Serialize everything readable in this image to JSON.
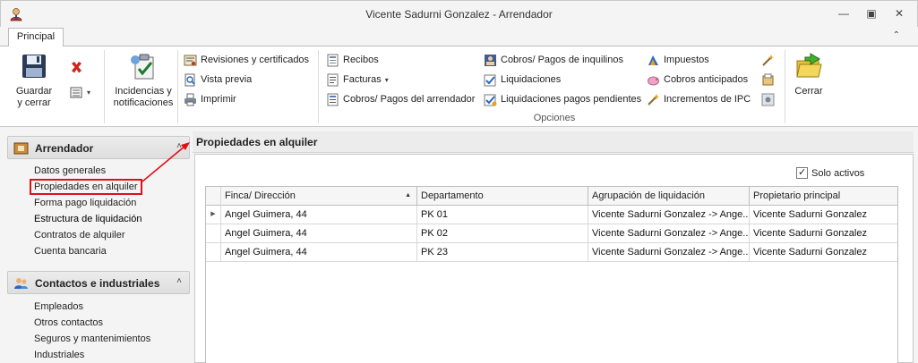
{
  "window": {
    "title": "Vicente Sadurni Gonzalez - Arrendador",
    "buttons": {
      "minimize": "—",
      "restore": "▣",
      "close": "✕"
    }
  },
  "ribbon": {
    "tab": "Principal",
    "collapse_symbol": "⌃",
    "save_line1": "Guardar",
    "save_line2": "y cerrar",
    "incidents_line1": "Incidencias y",
    "incidents_line2": "notificaciones",
    "col1": [
      "Revisiones y certificados",
      "Vista previa",
      "Imprimir"
    ],
    "col2": [
      "Recibos",
      "Facturas",
      "Cobros/ Pagos del arrendador"
    ],
    "col3": [
      "Cobros/ Pagos de inquilinos",
      "Liquidaciones",
      "Liquidaciones pagos pendientes"
    ],
    "col4": [
      "Impuestos",
      "Cobros anticipados",
      "Incrementos de IPC"
    ],
    "close_label": "Cerrar",
    "group_label": "Opciones",
    "dropdown_arrow": "▾"
  },
  "nav": {
    "section1": {
      "title": "Arrendador",
      "chevron": "˄",
      "items": [
        "Datos generales",
        "Propiedades en alquiler",
        "Forma pago liquidación",
        "Estructura de liquidación",
        "Contratos de alquiler",
        "Cuenta bancaria"
      ]
    },
    "section2": {
      "title": "Contactos e industriales",
      "chevron": "˄",
      "items": [
        "Empleados",
        "Otros contactos",
        "Seguros y mantenimientos",
        "Industriales"
      ]
    }
  },
  "content": {
    "title": "Propiedades en alquiler",
    "checkbox_label": "Solo activos",
    "checkbox_checked": true
  },
  "grid": {
    "columns": [
      "Finca/ Dirección",
      "Departamento",
      "Agrupación de liquidación",
      "Propietario principal"
    ],
    "sort_arrow": "▲",
    "row_indicator": "▶",
    "rows": [
      [
        "Angel Guimera, 44",
        "PK 01",
        "Vicente Sadurni Gonzalez -> Ange...",
        "Vicente Sadurni Gonzalez"
      ],
      [
        "Angel Guimera, 44",
        "PK 02",
        "Vicente Sadurni Gonzalez -> Ange...",
        "Vicente Sadurni Gonzalez"
      ],
      [
        "Angel Guimera, 44",
        "PK 23",
        "Vicente Sadurni Gonzalez -> Ange...",
        "Vicente Sadurni Gonzalez"
      ]
    ]
  },
  "colors": {
    "annotation_red": "#e0101a",
    "accent_blue": "#2b64c6"
  }
}
